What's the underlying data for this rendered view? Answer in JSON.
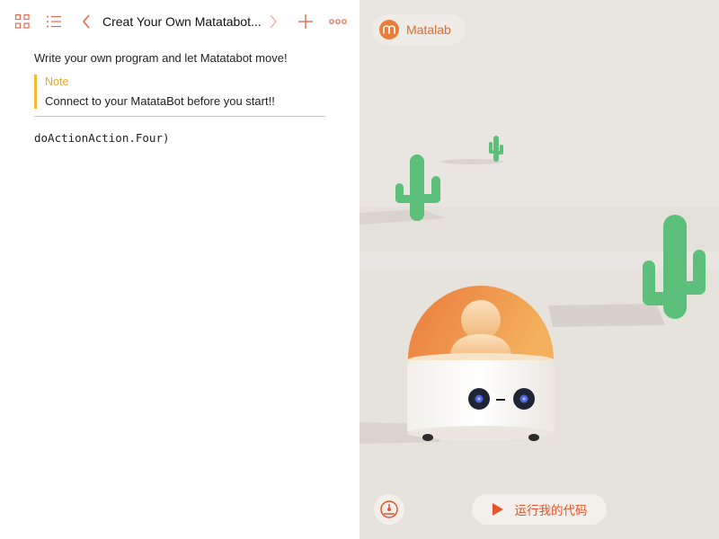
{
  "toolbar": {
    "title": "Creat Your Own Matatabot...",
    "icons": [
      "grid-icon",
      "list-icon",
      "back-icon",
      "forward-icon",
      "add-icon",
      "more-icon"
    ],
    "accent_color": "#e8694a"
  },
  "content": {
    "instruction": "Write your own program and let Matatabot move!",
    "note": {
      "title": "Note",
      "body": "Connect to your MatataBot before you start!!"
    },
    "code": "doActionAction.Four)"
  },
  "stage": {
    "app_badge": "Matalab",
    "run_button_label": "运行我的代码",
    "speed_icon": "speedometer-icon",
    "play_icon": "play-icon",
    "colors": {
      "background": "#e7e3de",
      "cactus": "#5cc07a",
      "dome": "#ef8e48",
      "accent": "#e5552c"
    }
  }
}
